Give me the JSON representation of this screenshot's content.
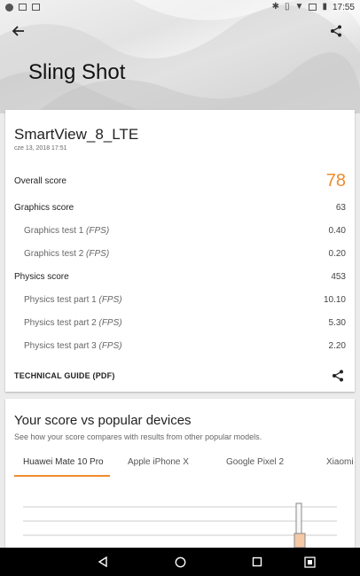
{
  "status_bar": {
    "time": "17:55"
  },
  "header": {
    "title": "Sling Shot",
    "back_icon": "arrow-back-icon",
    "share_icon": "share-icon"
  },
  "result_card": {
    "device_name": "SmartView_8_LTE",
    "date": "cze 13, 2018 17:51",
    "overall_label": "Overall score",
    "overall_value": "78",
    "graphics_label": "Graphics score",
    "graphics_value": "63",
    "gt1_label": "Graphics test 1",
    "gt1_value": "0.40",
    "gt2_label": "Graphics test 2",
    "gt2_value": "0.20",
    "physics_label": "Physics score",
    "physics_value": "453",
    "pt1_label": "Physics test part 1",
    "pt1_value": "10.10",
    "pt2_label": "Physics test part 2",
    "pt2_value": "5.30",
    "pt3_label": "Physics test part 3",
    "pt3_value": "2.20",
    "fps_unit": "(FPS)",
    "tech_guide_label": "TECHNICAL GUIDE (PDF)"
  },
  "compare_card": {
    "title": "Your score vs popular devices",
    "subtitle": "See how your score compares with results from other popular models.",
    "tabs": [
      "Huawei Mate 10 Pro",
      "Apple iPhone X",
      "Google Pixel 2",
      "Xiaomi"
    ],
    "active_tab": "Huawei Mate 10 Pro"
  },
  "colors": {
    "accent": "#f08b2d",
    "navbar": "#000000"
  }
}
